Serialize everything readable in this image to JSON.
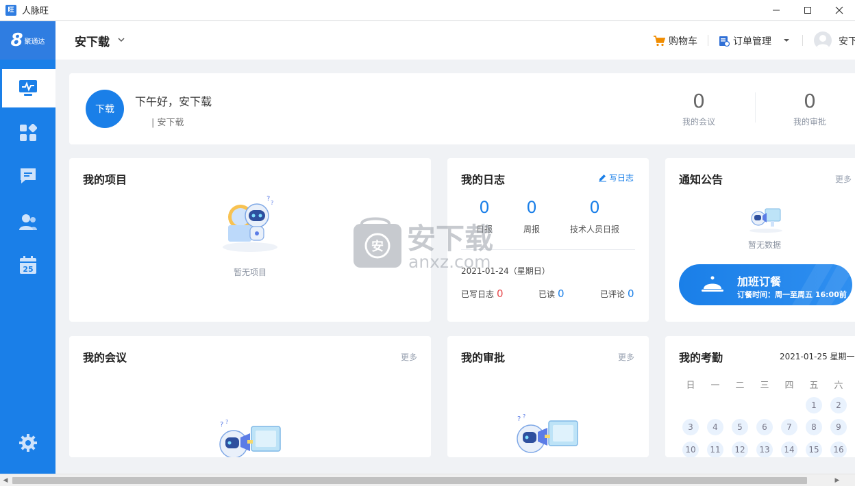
{
  "window": {
    "title": "人脉旺",
    "app_icon": "旺"
  },
  "sidebar": {
    "logo_text": "聚通达",
    "logo_mark": "8",
    "items": [
      {
        "name": "dashboard-icon",
        "active": true
      },
      {
        "name": "apps-grid-icon",
        "active": false
      },
      {
        "name": "message-icon",
        "active": false
      },
      {
        "name": "contacts-icon",
        "active": false
      },
      {
        "name": "calendar-icon",
        "active": false,
        "label": "25"
      }
    ]
  },
  "header": {
    "org_name": "安下载",
    "cart_label": "购物车",
    "orders_label": "订单管理",
    "username": "安下"
  },
  "welcome": {
    "avatar_text": "下载",
    "greeting": "下午好，安下载",
    "subtitle": "| 安下载",
    "meetings_count": "0",
    "meetings_label": "我的会议",
    "approvals_count": "0",
    "approvals_label": "我的审批"
  },
  "projects": {
    "title": "我的项目",
    "empty_text": "暂无项目"
  },
  "journal": {
    "title": "我的日志",
    "write_label": "写日志",
    "stats": [
      {
        "count": "0",
        "label": "日报"
      },
      {
        "count": "0",
        "label": "周报"
      },
      {
        "count": "0",
        "label": "技术人员日报"
      }
    ],
    "date": "2021-01-24（星期日）",
    "written_label": "已写日志",
    "written_count": "0",
    "read_label": "已读",
    "read_count": "0",
    "commented_label": "已评论",
    "commented_count": "0"
  },
  "notice": {
    "title": "通知公告",
    "more_label": "更多",
    "empty_text": "暂无数据",
    "overtime_title": "加班订餐",
    "overtime_sub": "订餐时间：周一至周五 16:00前"
  },
  "meetings": {
    "title": "我的会议",
    "more_label": "更多"
  },
  "approvals": {
    "title": "我的审批",
    "more_label": "更多"
  },
  "attendance": {
    "title": "我的考勤",
    "date": "2021-01-25 星期一",
    "weekdays": [
      "日",
      "一",
      "二",
      "三",
      "四",
      "五",
      "六"
    ],
    "days_row1": [
      "1",
      "2"
    ],
    "days_row2": [
      "3",
      "4",
      "5",
      "6",
      "7",
      "8",
      "9"
    ],
    "days_row3": [
      "10",
      "11",
      "12",
      "13",
      "14",
      "15",
      "16"
    ]
  },
  "watermark": {
    "text": "安下载",
    "sub": "anxz.com"
  },
  "colors": {
    "primary": "#1a7fe8",
    "sidebar": "#1a7fe8",
    "cart_orange": "#f08c00",
    "red": "#e6474b"
  }
}
